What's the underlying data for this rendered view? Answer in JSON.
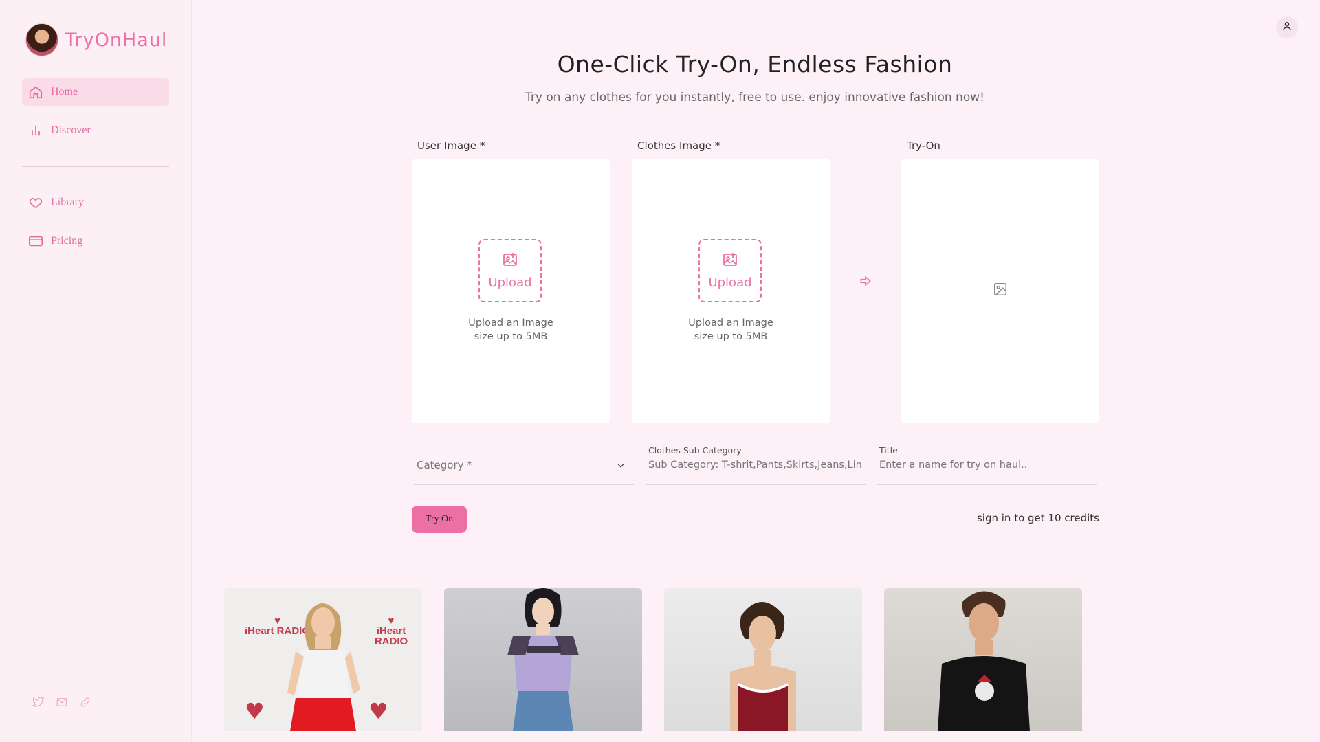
{
  "app": {
    "name": "TryOnHaul"
  },
  "sidebar": {
    "items": [
      {
        "label": "Home",
        "icon": "home-icon",
        "active": true
      },
      {
        "label": "Discover",
        "icon": "bar-chart-icon",
        "active": false
      },
      {
        "label": "Library",
        "icon": "heart-icon",
        "active": false
      },
      {
        "label": "Pricing",
        "icon": "credit-card-icon",
        "active": false
      }
    ],
    "socials": [
      "twitter-icon",
      "mail-icon",
      "link-icon"
    ]
  },
  "hero": {
    "title": "One-Click Try-On, Endless Fashion",
    "subtitle": "Try on any clothes for you instantly, free to use. enjoy innovative fashion now!"
  },
  "panels": {
    "user": {
      "label": "User Image *",
      "button": "Upload",
      "hint1": "Upload an Image",
      "hint2": "size up to 5MB"
    },
    "clothes": {
      "label": "Clothes Image *",
      "button": "Upload",
      "hint1": "Upload an Image",
      "hint2": "size up to 5MB"
    },
    "result": {
      "label": "Try-On"
    }
  },
  "form": {
    "category_placeholder": "Category *",
    "subcategory_label": "Clothes Sub Category",
    "subcategory_placeholder": "Sub Category: T-shrit,Pants,Skirts,Jeans,Lin",
    "title_label": "Title",
    "title_placeholder": "Enter a name for try on haul.."
  },
  "actions": {
    "try_on_label": "Try On",
    "credits_text": "sign in to get 10 credits"
  },
  "gallery": {
    "card1_logo": "iHeart RADIO"
  },
  "colors": {
    "accent": "#ec6fa6",
    "background": "#fdf0f6",
    "active_nav": "#fadbe8"
  }
}
